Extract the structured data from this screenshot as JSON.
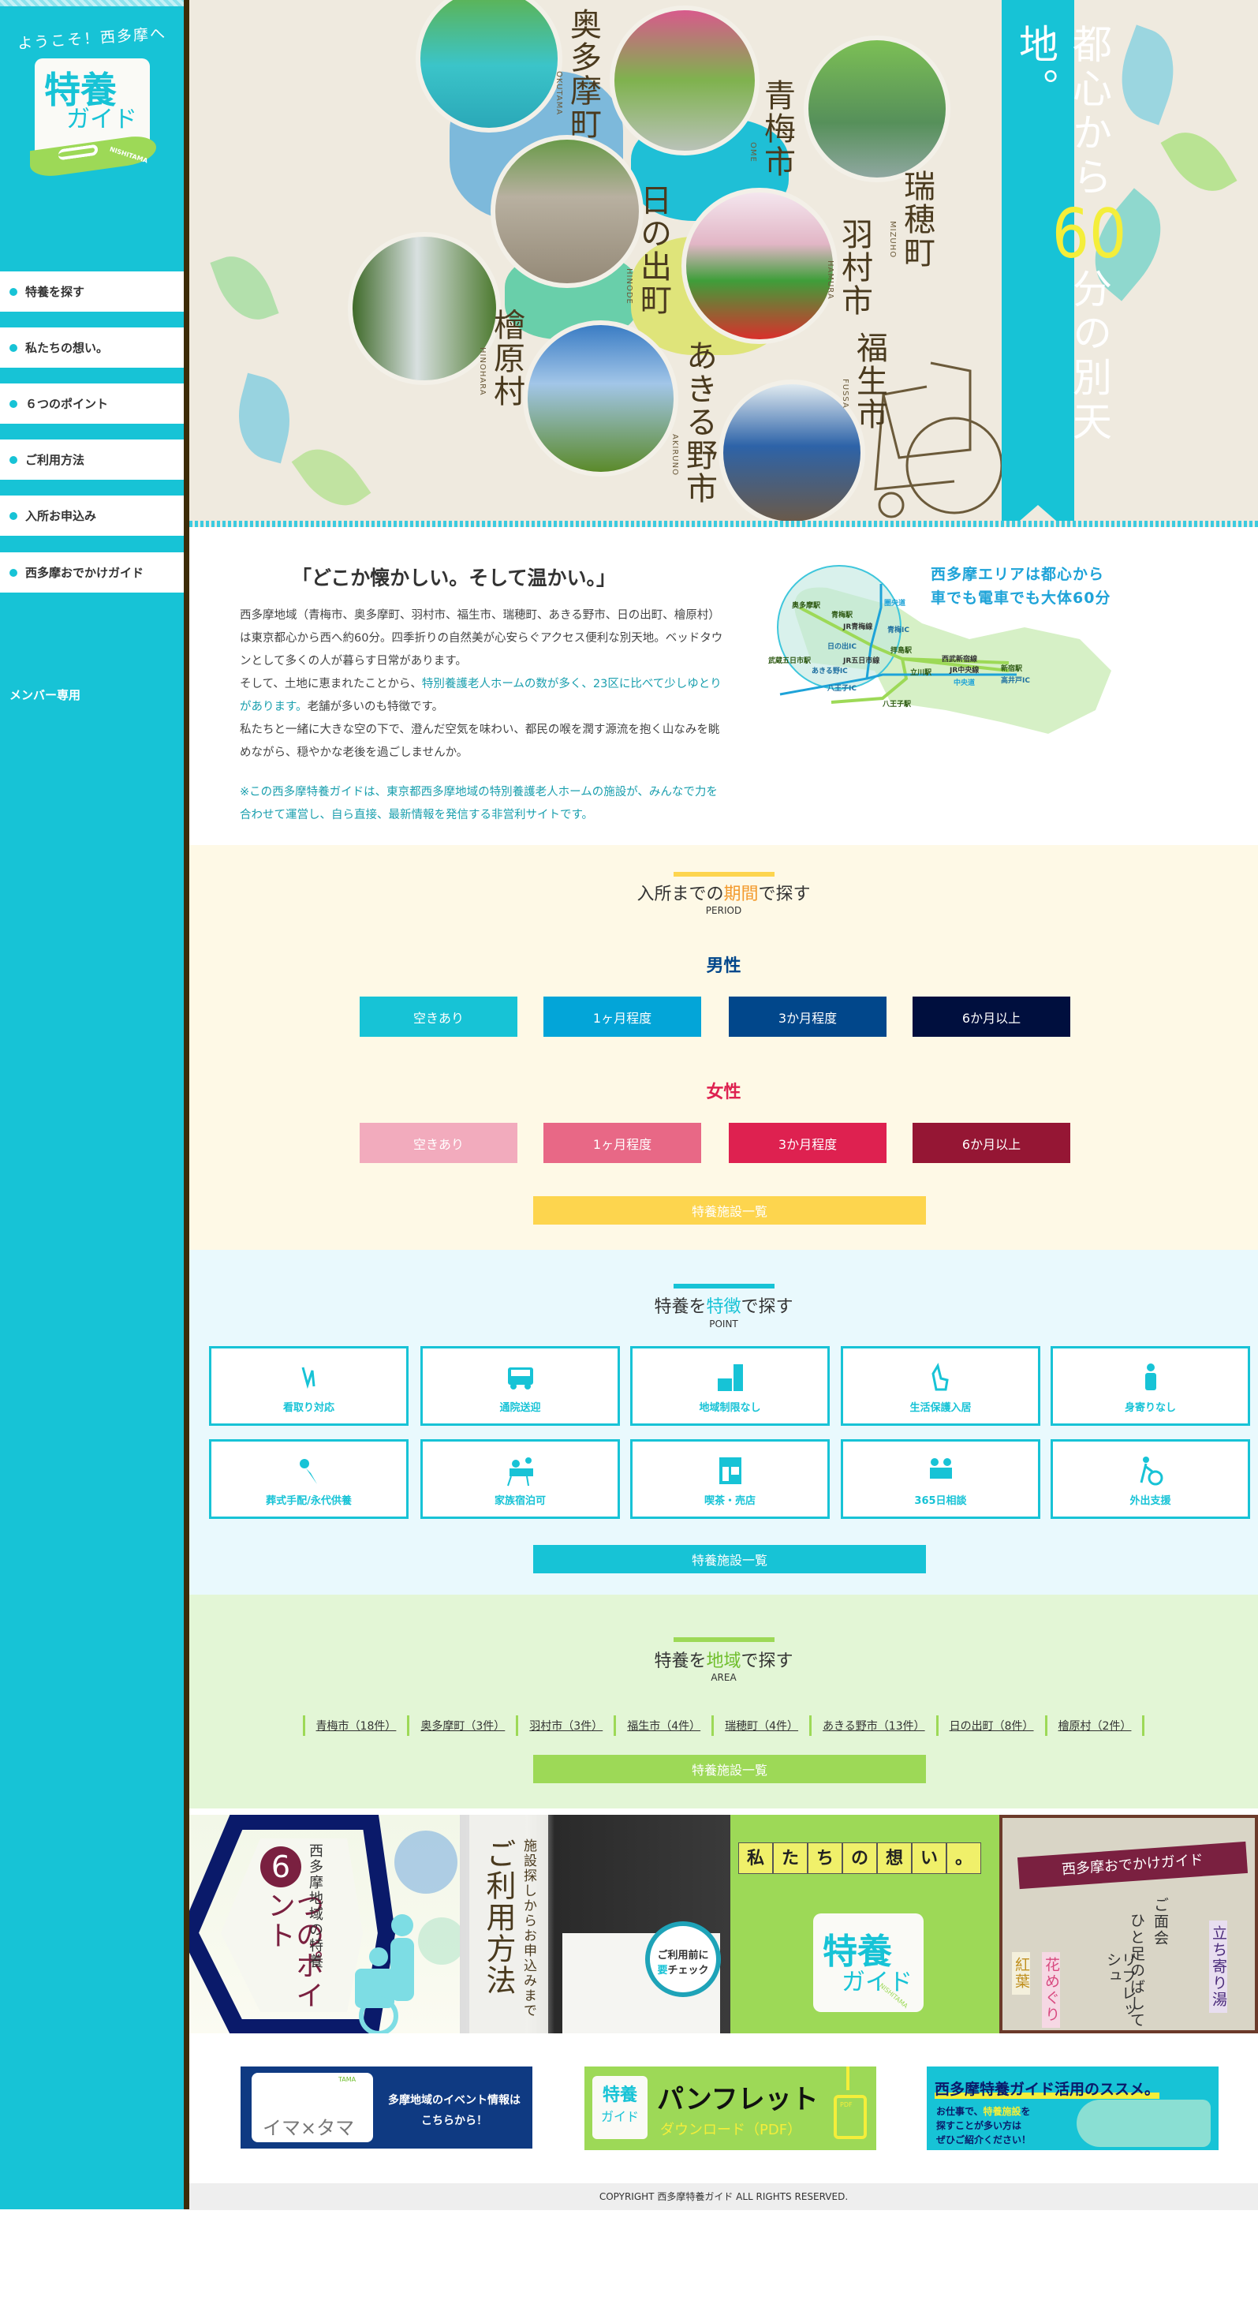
{
  "sidebar": {
    "welcome": "ようこそ！西多摩へ",
    "logo": {
      "line1": "特養",
      "line2": "ガイド",
      "tag": "NISHITAMA"
    },
    "nav": [
      {
        "label": "特養を探す"
      },
      {
        "label": "私たちの想い。"
      },
      {
        "label": "６つのポイント"
      },
      {
        "label": "ご利用方法"
      },
      {
        "label": "入所お申込み"
      },
      {
        "label": "西多摩おでかけガイド"
      }
    ],
    "member_label": "メンバー専用"
  },
  "hero": {
    "towns": [
      {
        "name": "奥多摩町",
        "roman": "OKUTAMA"
      },
      {
        "name": "青梅市",
        "roman": "OME"
      },
      {
        "name": "瑞穂町",
        "roman": "MIZUHO"
      },
      {
        "name": "日の出町",
        "roman": "HINODE"
      },
      {
        "name": "羽村市",
        "roman": "HAMURA"
      },
      {
        "name": "福生市",
        "roman": "FUSSA"
      },
      {
        "name": "檜原村",
        "roman": "HINOHARA"
      },
      {
        "name": "あきる野市",
        "roman": "AKIRUNO"
      }
    ],
    "ribbon": {
      "before": "都心から",
      "number": "60",
      "after": "分の別天地。"
    }
  },
  "intro": {
    "title": "「どこか懐かしい。そして温かい。」",
    "p1": "西多摩地域（青梅市、奥多摩町、羽村市、福生市、瑞穂町、あきる野市、日の出町、檜原村）は東京都心から西へ約60分。四季折りの自然美が心安らぐアクセス便利な別天地。ベッドタウンとして多くの人が暮らす日常があります。",
    "p2_start": "そして、土地に恵まれたことから、",
    "p2_highlight": "特別養護老人ホームの数が多く、23区に比べて少しゆとりがあります。",
    "p2_end": "老舗が多いのも特徴です。",
    "p3": "私たちと一緒に大きな空の下で、澄んだ空気を味わい、都民の喉を潤す源流を抱く山なみを眺めながら、穏やかな老後を過ごしませんか。",
    "note": "※この西多摩特養ガイドは、東京都西多摩地域の特別養護老人ホームの施設が、みんなで力を合わせて運営し、自ら直接、最新情報を発信する非営利サイトです。"
  },
  "access_map": {
    "caption_line1": "西多摩エリアは都心から",
    "caption_line2": "車でも電車でも大体60分",
    "labels": [
      "奥多摩駅",
      "青梅駅",
      "JR青梅線",
      "圏央道",
      "青梅IC",
      "日の出IC",
      "拝島駅",
      "武蔵五日市駅",
      "JR五日市線",
      "あきる野IC",
      "西武新宿線",
      "JR中央線",
      "立川駅",
      "新宿駅",
      "高井戸IC",
      "中央道",
      "八王子IC",
      "八王子駅"
    ]
  },
  "period": {
    "title_pre": "入所までの",
    "title_hl": "期間",
    "title_post": "で探す",
    "sub": "PERIOD",
    "male_label": "男性",
    "female_label": "女性",
    "options": [
      "空きあり",
      "1ヶ月程度",
      "3か月程度",
      "6か月以上"
    ],
    "male_colors": [
      "#17c3d6",
      "#03a5d8",
      "#01478b",
      "#000f3e"
    ],
    "female_colors": [
      "#f2abbd",
      "#e86886",
      "#de2150",
      "#951634"
    ],
    "list_button": "特養施設一覧"
  },
  "point": {
    "title_pre": "特養を",
    "title_hl": "特徴",
    "title_post": "で探す",
    "sub": "POINT",
    "features": [
      {
        "label": "看取り対応",
        "icon": "hands-icon"
      },
      {
        "label": "通院送迎",
        "icon": "bus-icon"
      },
      {
        "label": "地域制限なし",
        "icon": "blocks-icon"
      },
      {
        "label": "生活保護入居",
        "icon": "hand-coin-icon"
      },
      {
        "label": "身寄りなし",
        "icon": "person-icon"
      },
      {
        "label": "葬式手配/永代供養",
        "icon": "flower-icon"
      },
      {
        "label": "家族宿泊可",
        "icon": "family-icon"
      },
      {
        "label": "喫茶・売店",
        "icon": "shop-icon"
      },
      {
        "label": "365日相談",
        "icon": "consult-icon"
      },
      {
        "label": "外出支援",
        "icon": "wheelchair-icon"
      }
    ],
    "list_button": "特養施設一覧"
  },
  "area": {
    "title_pre": "特養を",
    "title_hl": "地域",
    "title_post": "で探す",
    "sub": "AREA",
    "links": [
      "青梅市（18件）",
      "奥多摩町（3件）",
      "羽村市（3件）",
      "福生市（4件）",
      "瑞穂町（4件）",
      "あきる野市（13件）",
      "日の出町（8件）",
      "檜原村（2件）"
    ],
    "list_button": "特養施設一覧"
  },
  "banners": {
    "six_points": {
      "number": "6",
      "title": "つのポイント",
      "sub": "西多摩地域の特養"
    },
    "usage": {
      "title": "ご利用方法",
      "sub": "施設探しからお申込みまで",
      "badge_line1": "ご利用前に",
      "badge_hl": "要",
      "badge_line2": "チェック"
    },
    "thoughts": {
      "title": [
        "私",
        "た",
        "ち",
        "の",
        "想",
        "い",
        "。"
      ],
      "logo1": "特養",
      "logo2": "ガイド",
      "tag": "NISHITAMA"
    },
    "outing": {
      "title": "西多摩おでかけガイド",
      "lines": [
        "ご面会",
        "ひと足のばして",
        "リフレッシュ"
      ],
      "tags": [
        "立ち寄り湯",
        "花めぐり",
        "紅葉"
      ]
    }
  },
  "bottom_banners": {
    "imatama": {
      "logo": "イマ×タマ",
      "logo_tag": "TAMA",
      "text1": "多摩地域のイベント情報は",
      "text2": "こちらから！"
    },
    "pamphlet": {
      "logo1": "特養",
      "logo2": "ガイド",
      "title": "パンフレット",
      "sub": "ダウンロード（PDF）",
      "pdf": "PDF"
    },
    "susume": {
      "title": "西多摩特養ガイド活用のススメ。",
      "line1_pre": "お仕事で、",
      "line1_hl": "特養施設",
      "line1_post": "を",
      "line2": "探すことが多い方は",
      "line3": "ぜひご紹介ください！"
    }
  },
  "footer": {
    "copyright": "COPYRIGHT 西多摩特養ガイド ALL RIGHTS RESERVED."
  }
}
